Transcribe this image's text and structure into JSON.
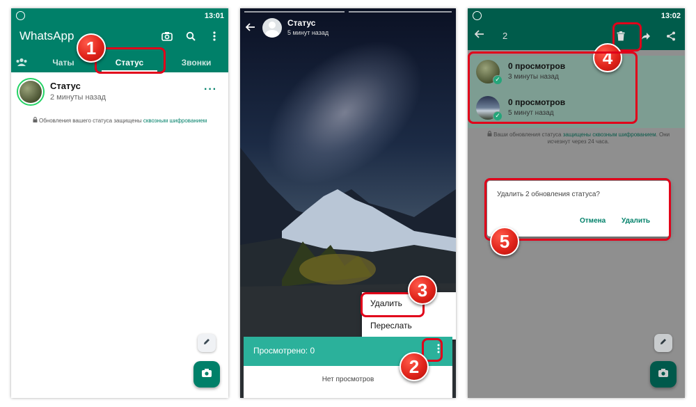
{
  "panel1": {
    "status_time": "13:01",
    "app_title": "WhatsApp",
    "tabs": {
      "chats": "Чаты",
      "status": "Статус",
      "calls": "Звонки"
    },
    "my_status": {
      "name": "Статус",
      "time": "2 минуты назад",
      "more": "···"
    },
    "encryption_note": {
      "text": "Обновления вашего статуса защищены",
      "link": "сквозным шифрованием"
    }
  },
  "panel2": {
    "title": "Статус",
    "time": "5 минут назад",
    "menu": {
      "delete": "Удалить",
      "forward": "Переслать"
    },
    "viewed_label": "Просмотрено: 0",
    "no_views": "Нет просмотров"
  },
  "panel3": {
    "status_time": "13:02",
    "selected_count": "2",
    "items": [
      {
        "title": "0 просмотров",
        "time": "3 минуты назад"
      },
      {
        "title": "0 просмотров",
        "time": "5 минут назад"
      }
    ],
    "note": {
      "before": "Ваши обновления статуса",
      "link": "защищены сквозным шифрованием",
      "after": ". Они исчезнут через 24 часа."
    },
    "dialog": {
      "message": "Удалить 2 обновления статуса?",
      "cancel": "Отмена",
      "delete": "Удалить"
    }
  },
  "annotations": [
    "1",
    "2",
    "3",
    "4",
    "5"
  ],
  "colors": {
    "brand_green": "#008069",
    "highlight_red": "#e1001a",
    "views_bar": "#2bb19b"
  }
}
